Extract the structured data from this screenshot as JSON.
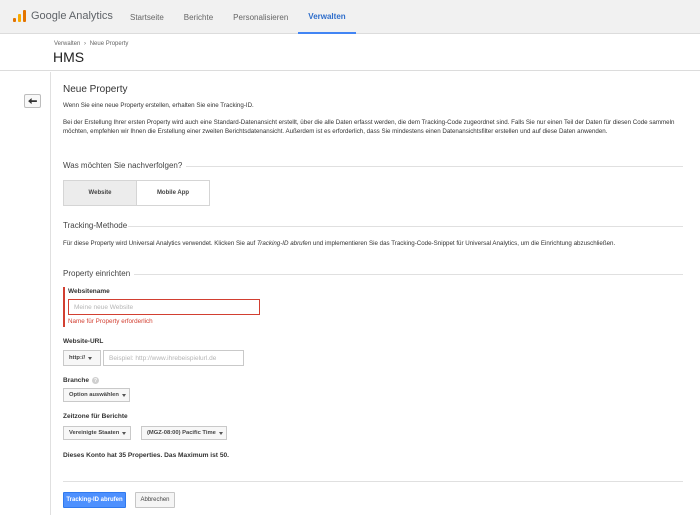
{
  "app": {
    "logo_text": "Google Analytics",
    "nav": [
      {
        "label": "Startseite"
      },
      {
        "label": "Berichte"
      },
      {
        "label": "Personalisieren"
      },
      {
        "label": "Verwalten"
      }
    ],
    "active_nav": "Verwalten"
  },
  "header": {
    "breadcrumb": [
      "Verwalten",
      "›",
      "Neue Property"
    ],
    "title": "HMS"
  },
  "main": {
    "heading": "Neue Property",
    "intro": "Wenn Sie eine neue Property erstellen, erhalten Sie eine Tracking-ID.",
    "description": "Bei der Erstellung Ihrer ersten Property wird auch eine Standard-Datenansicht erstellt, über die alle Daten erfasst werden, die dem Tracking-Code zugeordnet sind. Falls Sie nur einen Teil der Daten für diesen Code sammeln möchten, empfehlen wir Ihnen die Erstellung einer zweiten Berichtsdatenansicht. Außerdem ist es erforderlich, dass Sie mindestens einen Datenansichtsfilter erstellen und auf diese Daten anwenden.",
    "track_question": "Was möchten Sie nachverfolgen?",
    "tabs": [
      {
        "label": "Website"
      },
      {
        "label": "Mobile App"
      }
    ],
    "tracking_method_title": "Tracking-Methode",
    "tracking_method_text_1": "Für diese Property wird Universal Analytics verwendet. Klicken Sie auf ",
    "tracking_method_link": "Tracking-ID abrufen",
    "tracking_method_text_2": " und implementieren Sie das Tracking-Code-Snippet für Universal Analytics, um die Einrichtung abzuschließen.",
    "setup_title": "Property einrichten",
    "website_name_label": "Websitename",
    "website_name_placeholder": "Meine neue Website",
    "website_name_error": "Name für Property erforderlich",
    "website_url_label": "Website-URL",
    "url_protocol": "http://",
    "url_placeholder": "Beispiel: http://www.ihrebeispielurl.de",
    "industry_label": "Branche",
    "industry_help": "?",
    "industry_select": "Option auswählen",
    "timezone_label": "Zeitzone für Berichte",
    "timezone_country": "Vereinigte Staaten",
    "timezone_zone": "(MGZ-08:00) Pacific Time",
    "account_note": "Dieses Konto hat 35 Properties. Das Maximum ist 50.",
    "primary_button": "Tracking-ID abrufen",
    "cancel_button": "Abbrechen"
  },
  "colors": {
    "accent": "#4285f4",
    "primary_button": "#4d90fe",
    "error": "#d23f31"
  }
}
